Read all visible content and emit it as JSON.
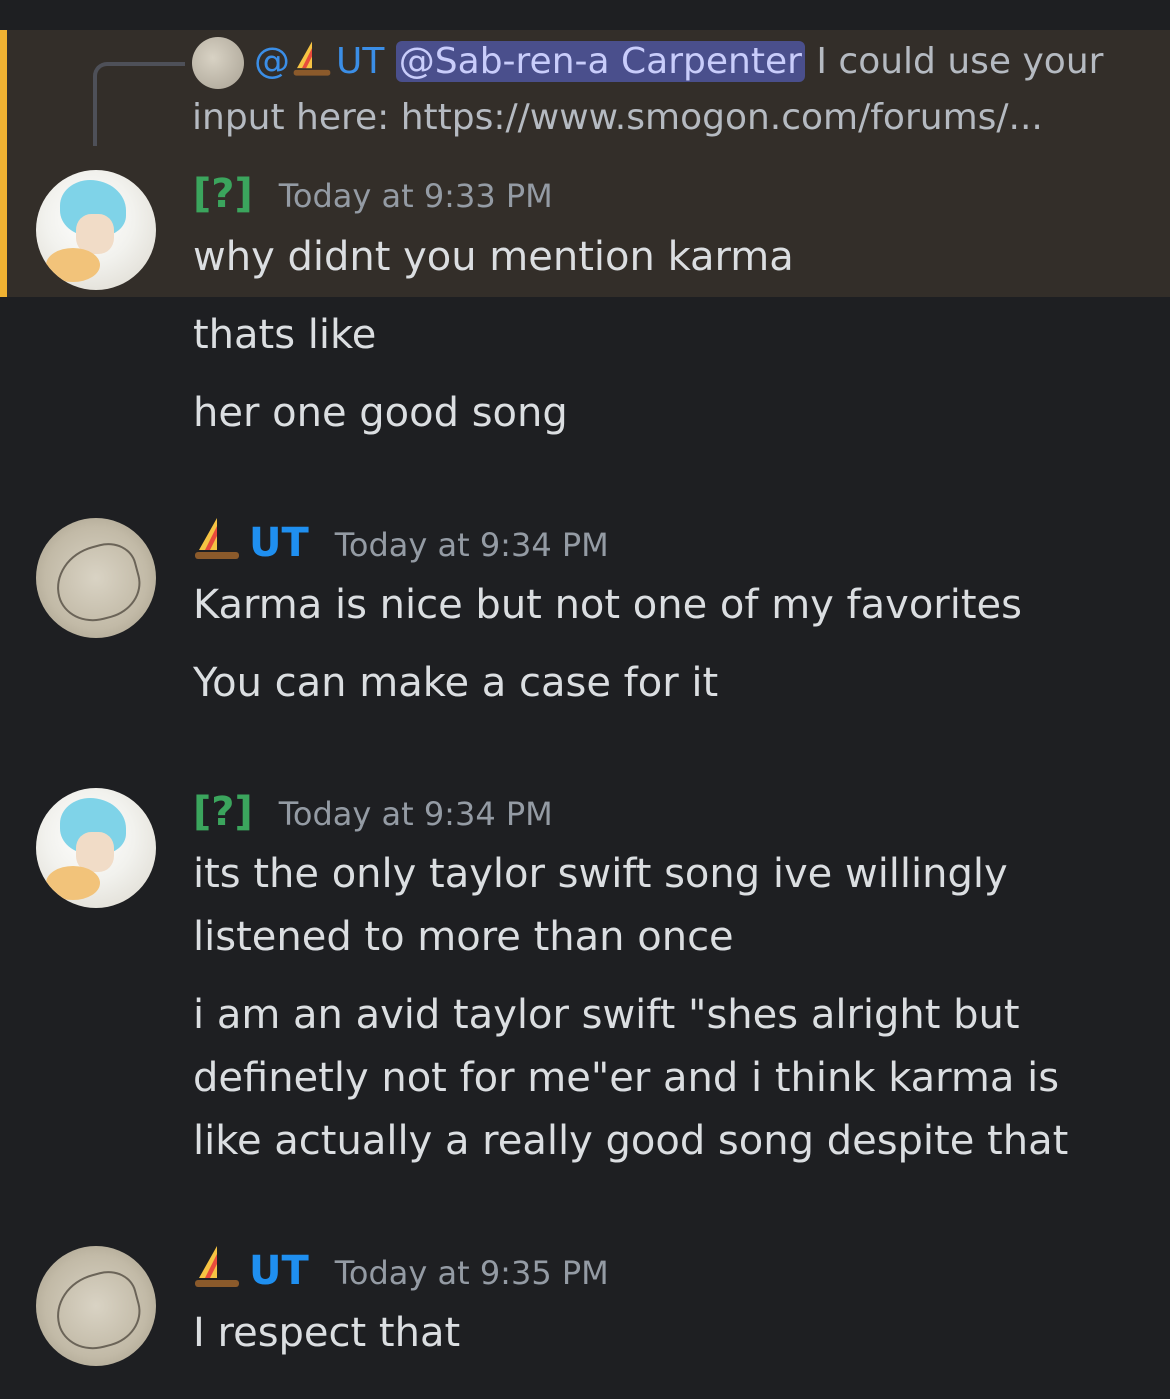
{
  "reply": {
    "at": "@",
    "user": "UT",
    "mention": "@Sab-ren-a Carpenter",
    "text_line1": " I could use your",
    "text_line2": "input here: https://www.smogon.com/forums/..."
  },
  "messages": [
    {
      "username": "[?]",
      "timestamp": "Today at 9:33 PM",
      "lines": [
        "why didnt you mention karma",
        "thats like",
        "her one good song"
      ]
    },
    {
      "username": "UT",
      "timestamp": "Today at 9:34 PM",
      "lines": [
        "Karma is nice but not one of my favorites",
        "You can make a case for it"
      ]
    },
    {
      "username": "[?]",
      "timestamp": "Today at 9:34 PM",
      "lines": [
        "its the only taylor swift song ive willingly",
        "listened to more than once",
        "i am an avid taylor swift \"shes alright but",
        "definetly not for me\"er and i think karma is",
        "like actually a really good song despite that"
      ]
    },
    {
      "username": "UT",
      "timestamp": "Today at 9:35 PM",
      "lines": [
        "I respect that"
      ]
    }
  ],
  "colors": {
    "background": "#1e1f22",
    "highlight": "#332e29",
    "highlight_bar": "#f0b232",
    "username_q": "#3ba55d",
    "username_ut": "#1f8ff0",
    "mention_bg": "#4a4f8c"
  },
  "icons": [
    "sailboat-icon",
    "avatar"
  ]
}
